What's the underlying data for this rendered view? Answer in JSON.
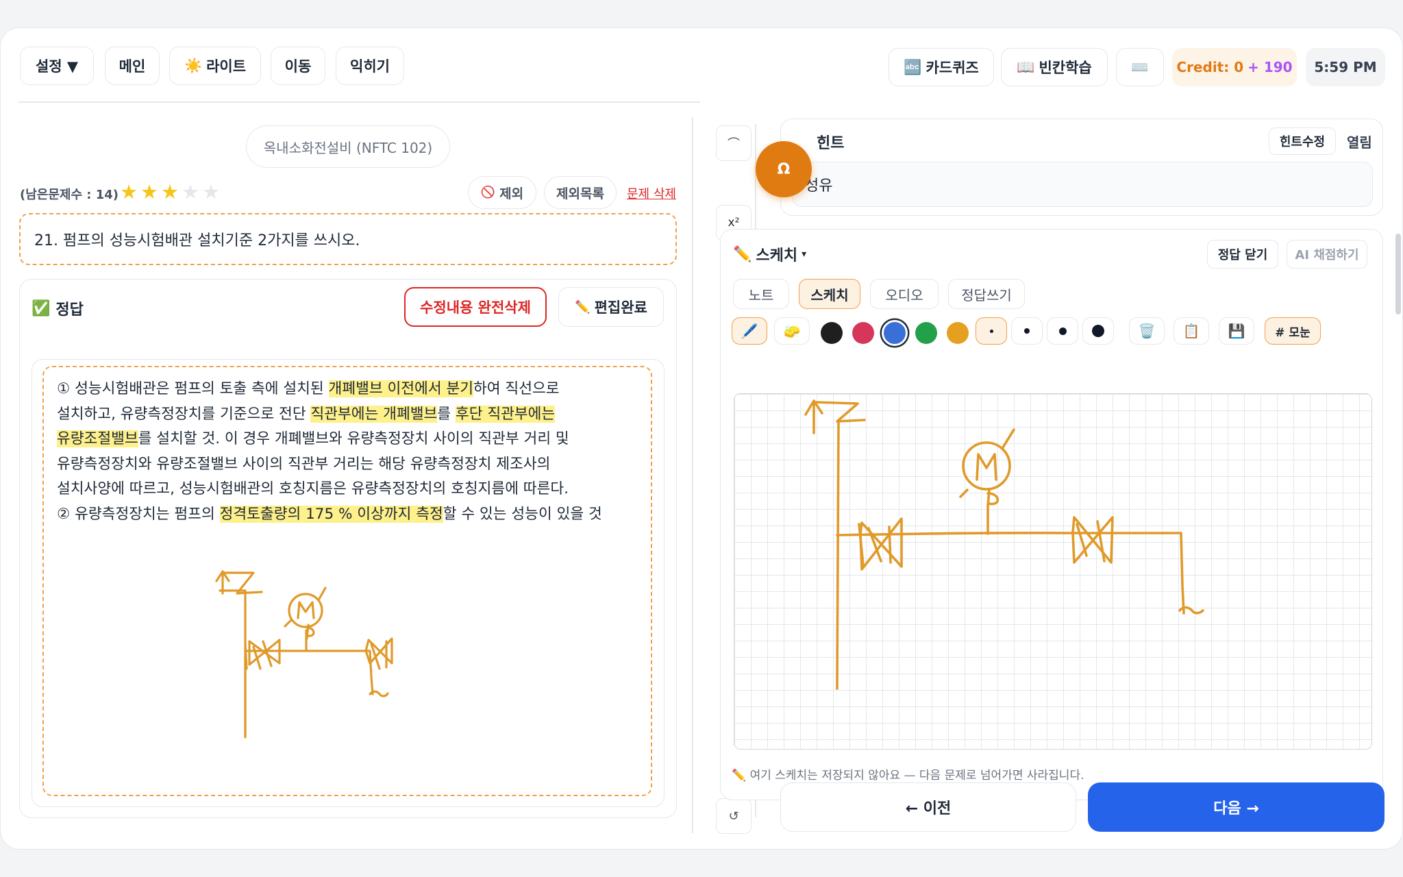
{
  "toolbar": {
    "settings": "설정 ▼",
    "main": "메인",
    "light_icon": "☀️",
    "light": "라이트",
    "move": "이동",
    "practice": "익히기",
    "cardquiz_icon": "🔤",
    "cardquiz": "카드퀴즈",
    "blank_icon": "📖",
    "blank": "빈칸학습",
    "keyboard_icon": "⌨️",
    "credit_label": "Credit: 0",
    "credit_bonus": "+ 190",
    "time": "5:59 PM"
  },
  "left": {
    "subject": "옥내소화전설비 (NFTC 102)",
    "remaining": "(남은문제수 : 14)",
    "stars_filled": 3,
    "stars_total": 5,
    "exclude_icon": "🚫",
    "exclude": "제외",
    "exclude_list": "제외목록",
    "delete_question": "문제 삭제",
    "question": "21. 펌프의 성능시험배관 설치기준 2가지를 쓰시오.",
    "answer_icon": "✅",
    "answer_title": "정답",
    "delete_edits": "수정내용 완전삭제",
    "edit_done_icon": "✏️",
    "edit_done": "편집완료",
    "answer_lines": [
      [
        {
          "t": "① 성능시험배관은 펌프의 토출 측에 설치된 ",
          "h": false
        },
        {
          "t": "개폐밸브 이전에서 분기",
          "h": true
        },
        {
          "t": "하여 직선으로",
          "h": false
        }
      ],
      [
        {
          "t": "설치하고, 유량측정장치를 기준으로 전단 ",
          "h": false
        },
        {
          "t": "직관부에는 개폐밸브",
          "h": true
        },
        {
          "t": "를 ",
          "h": false
        },
        {
          "t": "후단 직관부에는",
          "h": true
        }
      ],
      [
        {
          "t": "유량조절밸브",
          "h": true
        },
        {
          "t": "를 설치할 것. 이 경우 개폐밸브와 유량측정장치 사이의 직관부 거리 및",
          "h": false
        }
      ],
      [
        {
          "t": "유량측정장치와 유량조절밸브 사이의 직관부 거리는 해당 유량측정장치 제조사의",
          "h": false
        }
      ],
      [
        {
          "t": "설치사양에 따르고, 성능시험배관의 호칭지름은 유량측정장치의 호칭지름에 따른다.",
          "h": false
        }
      ],
      [
        {
          "t": "② 유량측정장치는 펌프의 ",
          "h": false
        },
        {
          "t": "정격토출량의 175 % 이상까지 측정",
          "h": true
        },
        {
          "t": "할 수 있는 성능이 있을 것",
          "h": false
        }
      ]
    ]
  },
  "right": {
    "omega": "Ω",
    "undo_icon": "⌒",
    "superscript": "x²",
    "reset_icon": "↺",
    "hint_title": "힌트",
    "hint_edit": "힌트수정",
    "hint_open": "열림",
    "hint_text": "성유",
    "sketch_icon": "✏️",
    "sketch_title": "스케치",
    "sketch_caret": "▾",
    "close_answer": "정답 닫기",
    "ai_grade": "AI 채점하기",
    "tabs": [
      "노트",
      "스케치",
      "오디오",
      "정답쓰기"
    ],
    "active_tab": "스케치",
    "pen_icon": "🖊️",
    "eraser_icon": "🧽",
    "colors": [
      "#1f1f1f",
      "#d6365a",
      "#3b6fd8",
      "#23a04a",
      "#e6a020"
    ],
    "selected_color": "#3b6fd8",
    "trash_icon": "🗑️",
    "clipboard_icon": "📋",
    "save_icon": "💾",
    "grid_label": "# 모눈",
    "sketch_note": "✏️ 여기 스케치는 저장되지 않아요 — 다음 문제로 넘어가면 사라집니다.",
    "prev": "← 이전",
    "next": "다음 →",
    "stroke_color": "#e09a2a"
  }
}
